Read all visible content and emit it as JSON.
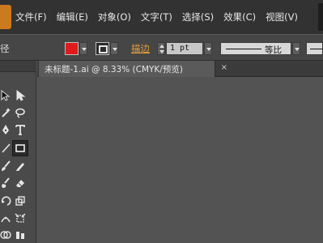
{
  "menubar": {
    "items": [
      "文件(F)",
      "编辑(E)",
      "对象(O)",
      "文字(T)",
      "选择(S)",
      "效果(C)",
      "视图(V)"
    ]
  },
  "controlbar": {
    "left_label": "径",
    "fill_color": "#e11b1b",
    "stroke_label": "描边",
    "stroke_width": "1 pt",
    "profile_label": "等比"
  },
  "document": {
    "tab_title": "未标题-1.ai @ 8.33% (CMYK/预览)",
    "close_glyph": "×"
  },
  "toolbar": {
    "tools": [
      "selection-tool-icon",
      "direct-selection-tool-icon",
      "magic-wand-tool-icon",
      "lasso-tool-icon",
      "pen-tool-icon",
      "type-tool-icon",
      "line-tool-icon",
      "rectangle-tool-icon",
      "paintbrush-tool-icon",
      "pencil-tool-icon",
      "blob-brush-tool-icon",
      "eraser-tool-icon",
      "rotate-tool-icon",
      "scale-tool-icon",
      "width-tool-icon",
      "free-transform-tool-icon",
      "shape-builder-tool-icon",
      "perspective-tool-icon"
    ]
  }
}
